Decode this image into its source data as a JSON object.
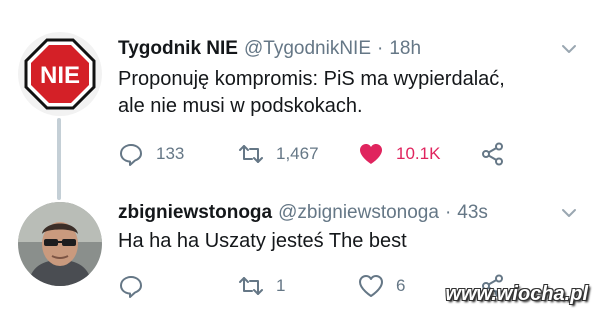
{
  "tweets": [
    {
      "display_name": "Tygodnik NIE",
      "handle": "@TygodnikNIE",
      "separator": "·",
      "time": "18h",
      "text_line1": "Proponuję kompromis: PiS ma wypierdalać,",
      "text_line2": "ale nie musi w podskokach.",
      "avatar_icon": "stop-sign-nie-logo",
      "avatar_text": "NIE",
      "replies": "133",
      "retweets": "1,467",
      "likes": "10.1K",
      "liked": true
    },
    {
      "display_name": "zbigniewstonoga",
      "handle": "@zbigniewstonoga",
      "separator": "·",
      "time": "43s",
      "text_line1": "Ha ha ha Uszaty jesteś The best",
      "avatar_icon": "profile-photo",
      "replies": "",
      "retweets": "1",
      "likes": "6",
      "liked": false
    }
  ],
  "watermark": "www.wiocha.pl",
  "colors": {
    "like_active": "#e0245e",
    "muted": "#657786",
    "thread_line": "#c4cfd6",
    "stop_sign": "#d42027"
  }
}
